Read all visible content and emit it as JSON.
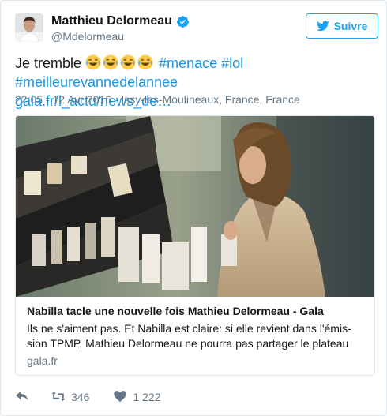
{
  "user": {
    "display_name": "Matthieu Delormeau",
    "handle": "@Mdelormeau",
    "verified": true
  },
  "follow_button": {
    "label": "Suivre",
    "icon": "twitter-bird-icon"
  },
  "tweet": {
    "text_start": "Je tremble",
    "emoji": [
      "face-with-tears-of-joy",
      "face-with-tears-of-joy",
      "face-with-tears-of-joy",
      "face-with-tears-of-joy"
    ],
    "hashtags": [
      "#menace",
      "#lol",
      "#meilleurevannedelannee"
    ],
    "link": "gala.fr/l_actu/news_de…"
  },
  "meta": {
    "time": "22:05 - 12 Avr 2016",
    "separator": "·",
    "location": "Issy-les-Moulineaux, France, France"
  },
  "card": {
    "title": "Nabilla tacle une nouvelle fois Mathieu Delormeau - Gala",
    "description_line1": "Ils ne s'aiment pas. Et Nabilla est claire: si elle revient dans l'émis-",
    "description_line2": "sion TPMP, Mathieu Delormeau ne pourra pas partager le plateau",
    "domain": "gala.fr"
  },
  "actions": {
    "reply_icon": "reply-icon",
    "retweet_icon": "retweet-icon",
    "retweet_count": "346",
    "like_icon": "heart-icon",
    "like_count": "1 222"
  },
  "colors": {
    "brand_blue": "#1da1f2",
    "link_blue": "#1b95e0",
    "muted": "#657786",
    "border": "#e1e8ed"
  }
}
